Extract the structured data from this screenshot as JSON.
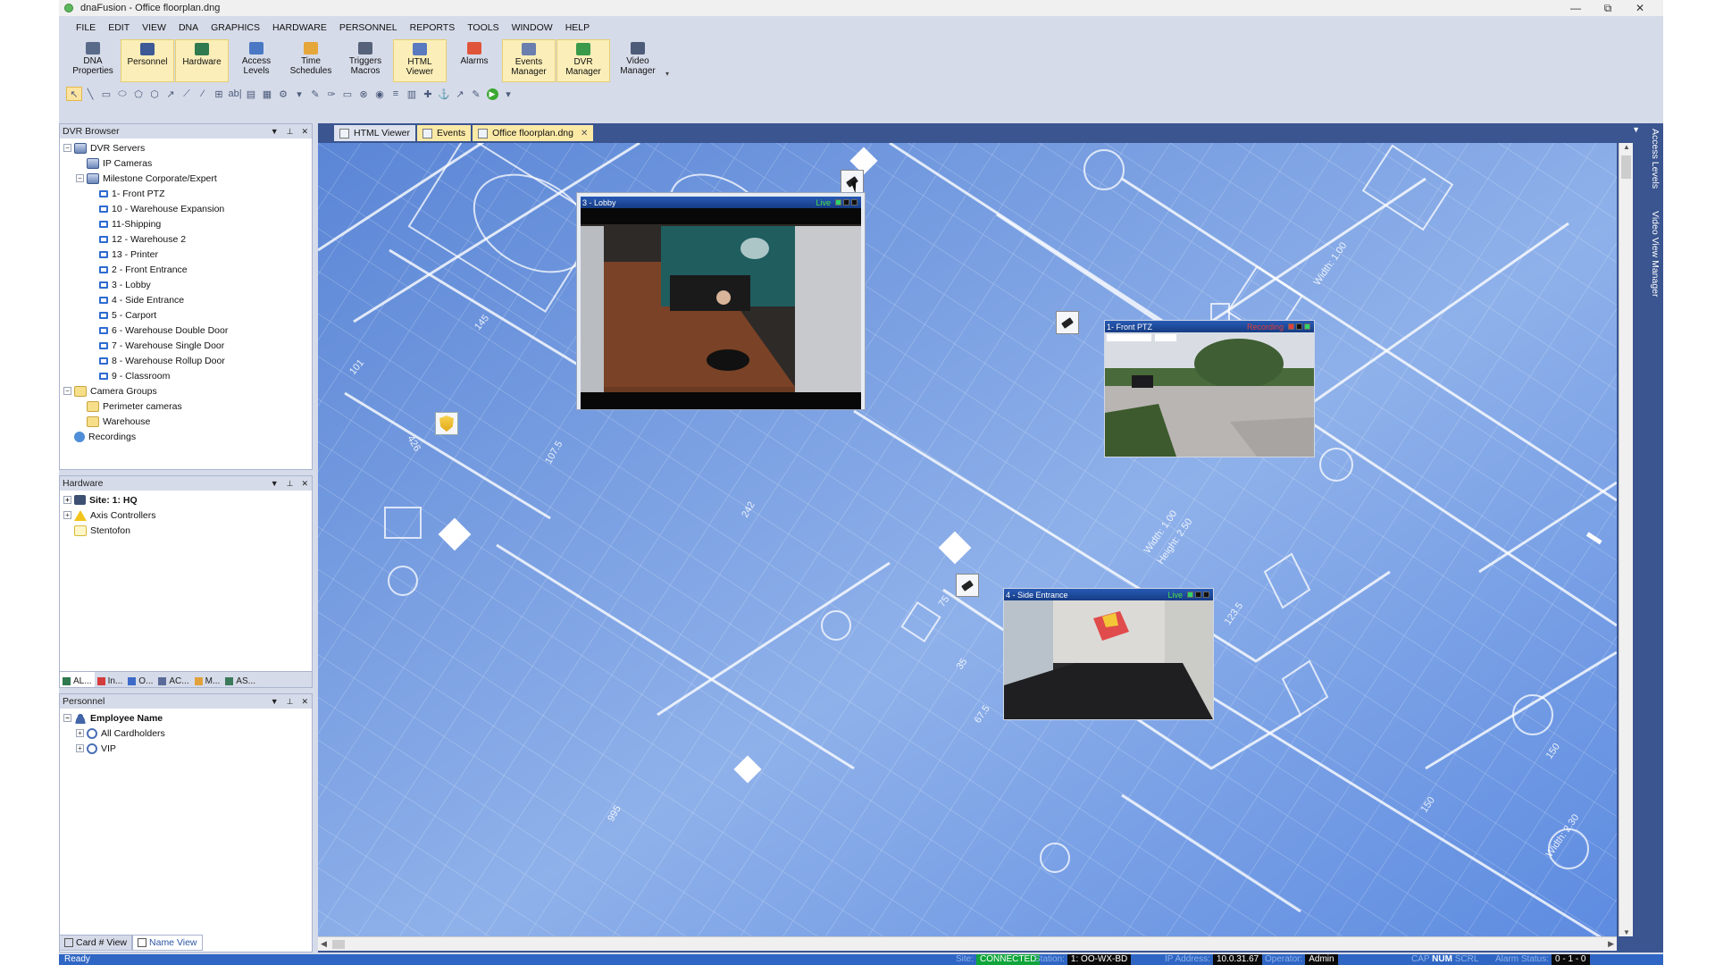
{
  "window": {
    "title": "dnaFusion - Office floorplan.dng",
    "controls": [
      "—",
      "⧉",
      "✕"
    ]
  },
  "menu": [
    "FILE",
    "EDIT",
    "VIEW",
    "DNA",
    "GRAPHICS",
    "HARDWARE",
    "PERSONNEL",
    "REPORTS",
    "TOOLS",
    "WINDOW",
    "HELP"
  ],
  "ribbon": [
    {
      "label": "DNA\nProperties",
      "icon": "gear-icon",
      "color": "#5a6b8a",
      "active": false
    },
    {
      "label": "Personnel",
      "icon": "person-badge-icon",
      "color": "#3d5a96",
      "active": true
    },
    {
      "label": "Hardware",
      "icon": "hardware-icon",
      "color": "#2f7a4f",
      "active": true
    },
    {
      "label": "Access\nLevels",
      "icon": "access-levels-icon",
      "color": "#4a78c4",
      "active": false
    },
    {
      "label": "Time\nSchedules",
      "icon": "clock-icon",
      "color": "#e5a63a",
      "active": false
    },
    {
      "label": "Triggers\nMacros",
      "icon": "trigger-icon",
      "color": "#56627a",
      "active": false
    },
    {
      "label": "HTML\nViewer",
      "icon": "html-viewer-icon",
      "color": "#5a7ac0",
      "active": true
    },
    {
      "label": "Alarms",
      "icon": "alarm-icon",
      "color": "#e0553a",
      "active": false
    },
    {
      "label": "Events\nManager",
      "icon": "events-icon",
      "color": "#6a7fae",
      "active": true
    },
    {
      "label": "DVR\nManager",
      "icon": "dvr-icon",
      "color": "#3a9a4a",
      "active": true
    },
    {
      "label": "Video\nManager",
      "icon": "video-icon",
      "color": "#4c5b78",
      "active": false
    }
  ],
  "tools": [
    "↖",
    "╲",
    "▭",
    "⬭",
    "⬠",
    "⬡",
    "↗",
    "⟋",
    "⁄",
    "⊞",
    "ab|",
    "▤",
    "▦",
    "⚙",
    "▾",
    "✎",
    "✑",
    "▭",
    "⊗",
    "◉",
    "≡",
    "▥",
    "✚",
    "⚓",
    "↗",
    "✎",
    "▶",
    "▾"
  ],
  "dvr_browser": {
    "title": "DVR Browser",
    "items": [
      {
        "label": "DVR Servers",
        "level": 0,
        "icon": "server",
        "exp": "−"
      },
      {
        "label": "IP Cameras",
        "level": 1,
        "icon": "server",
        "exp": ""
      },
      {
        "label": "Milestone Corporate/Expert",
        "level": 1,
        "icon": "server",
        "exp": "−"
      },
      {
        "label": "1- Front PTZ",
        "level": 2,
        "icon": "cam",
        "exp": ""
      },
      {
        "label": "10 - Warehouse Expansion",
        "level": 2,
        "icon": "cam",
        "exp": ""
      },
      {
        "label": "11-Shipping",
        "level": 2,
        "icon": "cam",
        "exp": ""
      },
      {
        "label": "12 - Warehouse 2",
        "level": 2,
        "icon": "cam",
        "exp": ""
      },
      {
        "label": "13 - Printer",
        "level": 2,
        "icon": "cam",
        "exp": ""
      },
      {
        "label": "2 - Front Entrance",
        "level": 2,
        "icon": "cam",
        "exp": ""
      },
      {
        "label": "3 - Lobby",
        "level": 2,
        "icon": "cam",
        "exp": ""
      },
      {
        "label": "4 - Side Entrance",
        "level": 2,
        "icon": "cam",
        "exp": ""
      },
      {
        "label": "5 - Carport",
        "level": 2,
        "icon": "cam",
        "exp": ""
      },
      {
        "label": "6 - Warehouse Double Door",
        "level": 2,
        "icon": "cam",
        "exp": ""
      },
      {
        "label": "7 - Warehouse Single Door",
        "level": 2,
        "icon": "cam",
        "exp": ""
      },
      {
        "label": "8 - Warehouse Rollup Door",
        "level": 2,
        "icon": "cam",
        "exp": ""
      },
      {
        "label": "9 - Classroom",
        "level": 2,
        "icon": "cam",
        "exp": ""
      },
      {
        "label": "Camera Groups",
        "level": 0,
        "icon": "folder",
        "exp": "−"
      },
      {
        "label": "Perimeter cameras",
        "level": 1,
        "icon": "folder",
        "exp": ""
      },
      {
        "label": "Warehouse",
        "level": 1,
        "icon": "folder",
        "exp": ""
      },
      {
        "label": "Recordings",
        "level": 0,
        "icon": "rec",
        "exp": ""
      }
    ]
  },
  "hardware": {
    "title": "Hardware",
    "items": [
      {
        "label": "Site: 1: HQ",
        "level": 0,
        "icon": "site",
        "exp": "+",
        "bold": true
      },
      {
        "label": "Axis Controllers",
        "level": 0,
        "icon": "warn",
        "exp": "+",
        "bold": false
      },
      {
        "label": "Stentofon",
        "level": 0,
        "icon": "note",
        "exp": "",
        "bold": false
      }
    ],
    "tabs": [
      "AL...",
      "In...",
      "O...",
      "AC...",
      "M...",
      "AS..."
    ]
  },
  "personnel": {
    "title": "Personnel",
    "items": [
      {
        "label": "Employee Name",
        "level": 0,
        "icon": "person",
        "exp": "−",
        "bold": true
      },
      {
        "label": "All Cardholders",
        "level": 1,
        "icon": "group",
        "exp": "+",
        "bold": false
      },
      {
        "label": "VIP",
        "level": 1,
        "icon": "group",
        "exp": "+",
        "bold": false
      }
    ],
    "view_tabs": [
      "Card # View",
      "Name View"
    ]
  },
  "doc_tabs": [
    {
      "label": "HTML Viewer",
      "closable": false
    },
    {
      "label": "Events",
      "closable": false
    },
    {
      "label": "Office floorplan.dng",
      "closable": true
    }
  ],
  "side_strip": [
    "Access Levels",
    "Video View Manager"
  ],
  "videos": {
    "lobby": {
      "title": "3 - Lobby",
      "status": "Live"
    },
    "front": {
      "title": "1- Front PTZ",
      "status": "Recording"
    },
    "side": {
      "title": "4 - Side Entrance",
      "status": "Live"
    }
  },
  "status": {
    "ready": "Ready",
    "site_label": "Site:",
    "site_value": "CONNECTED",
    "station_label": "Station:",
    "station_value": "1: OO-WX-BD",
    "ip_label": "IP Address:",
    "ip_value": "10.0.31.67",
    "operator_label": "Operator:",
    "operator_value": "Admin",
    "cap": "CAP",
    "num": "NUM",
    "scrl": "SCRL",
    "alarm_label": "Alarm Status:",
    "alarm_value": "0 - 1 - 0"
  }
}
